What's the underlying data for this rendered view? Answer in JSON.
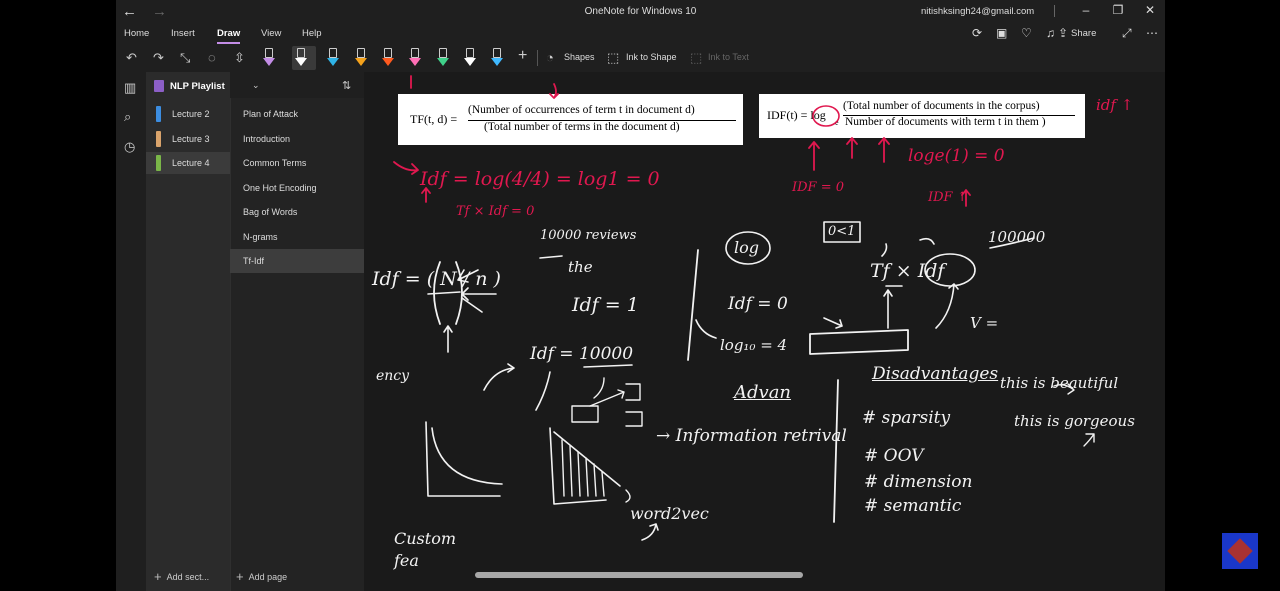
{
  "window": {
    "title": "OneNote for Windows 10",
    "account": "nitishksingh24@gmail.com"
  },
  "ribbon": {
    "tabs": [
      "Home",
      "Insert",
      "Draw",
      "View",
      "Help"
    ],
    "active_tab": "Draw",
    "share_label": "Share"
  },
  "toolbar": {
    "shapes_label": "Shapes",
    "ink_to_shape_label": "Ink to Shape",
    "ink_to_text_label": "Ink to Text",
    "pen_colors": [
      "#c38de6",
      "#ffffff",
      "#2fb3e6",
      "#f4a21c",
      "#ff5a1f",
      "#ff6fb5",
      "#40d18a",
      "#ffffff",
      "#3fb9ff"
    ]
  },
  "notebook": {
    "name": "NLP Playlist",
    "sections": [
      {
        "label": "Lecture 2",
        "color": "#3c8de0"
      },
      {
        "label": "Lecture 3",
        "color": "#d9a36b"
      },
      {
        "label": "Lecture 4",
        "color": "#7ab648"
      }
    ],
    "active_section": "Lecture 4",
    "pages": [
      "Plan of Attack",
      "Introduction",
      "Common Terms",
      "One Hot Encoding",
      "Bag of Words",
      "N-grams",
      "Tf-Idf"
    ],
    "active_page": "Tf-Idf",
    "add_section_label": "Add sect...",
    "add_page_label": "Add page"
  },
  "canvas": {
    "tf_formula": {
      "lhs": "TF(t, d) =",
      "numerator": "(Number of occurrences of term t in document d)",
      "denominator": "(Total number of terms in the document d)"
    },
    "idf_formula": {
      "lhs": "IDF(t) = log",
      "subscript": "e",
      "numerator": "(Total number of documents in the corpus)",
      "denominator": "Number of documents with term t in them )"
    },
    "ink_notes": {
      "idf_eq": "Idf = log(4/4) = log1 = 0",
      "tfxidf": "Tf × Idf = 0",
      "loge1": "loge(1) = 0",
      "idf_eq0": "IDF = 0",
      "idf_up": "IDF ↑",
      "idf_up_right": "idf ↑",
      "reviews": "10000 reviews",
      "the": "the",
      "idf_is_1": "Idf = 1",
      "idf_formula_hand": "Idf = ( N / n )",
      "log_circle": "log",
      "idf_0": "Idf = 0",
      "log10": "log₁₀ = 4",
      "zero_to_one": "0<1",
      "tf_times_idf": "Tf × Idf",
      "hundred_thousand": "100000",
      "v_eq": "V =",
      "idf_10000": "Idf = 10000",
      "ency": "ency",
      "advan": "Advan",
      "information_retrival": "→ Information retrival",
      "disadvantages": "Disadvantages",
      "sparsity": "# sparsity",
      "oov": "# OOV",
      "dimension": "# dimension",
      "semantic": "# semantic",
      "this_is_beautiful": "this is beautiful",
      "this_is_gorgeous": "this is gorgeous",
      "word2vec": "word2vec",
      "custom_fea": "Custom fea"
    }
  }
}
